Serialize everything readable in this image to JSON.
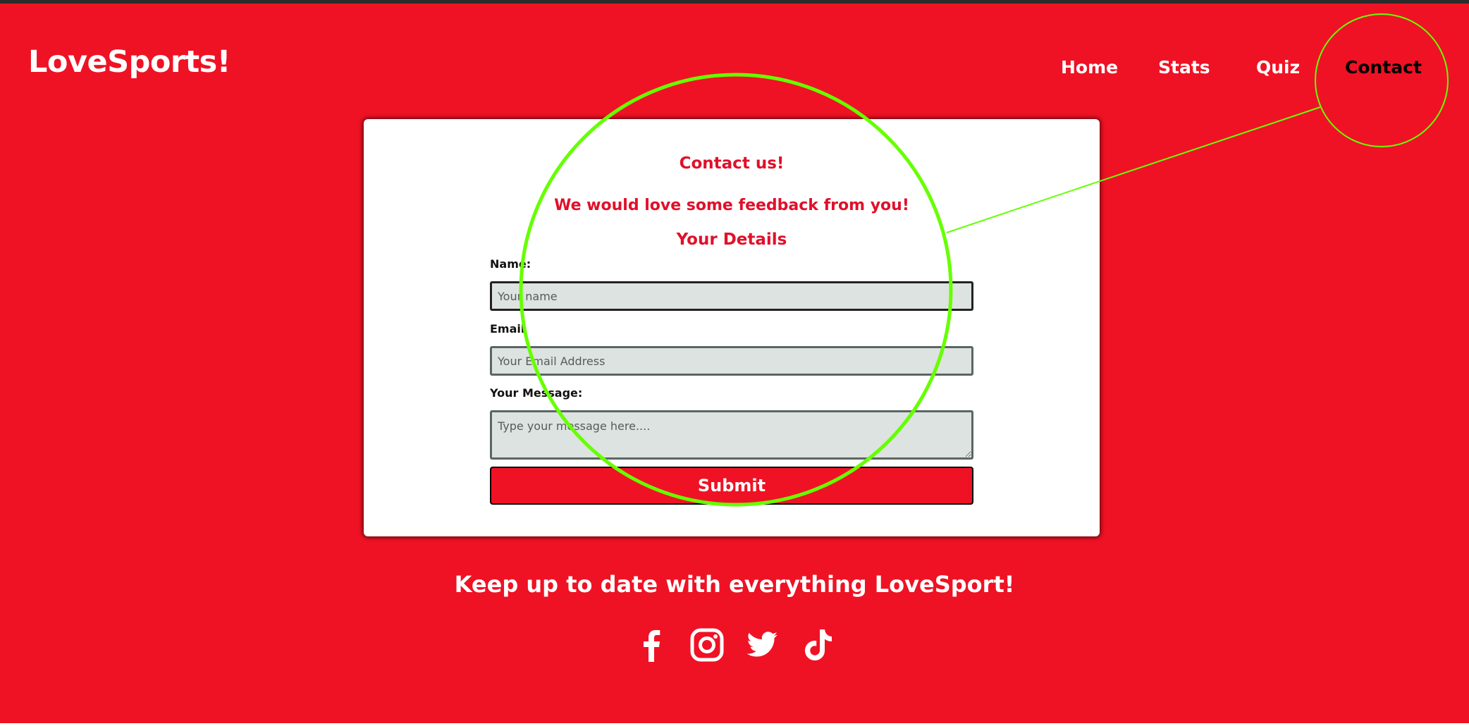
{
  "brand": {
    "logo": "LoveSports!"
  },
  "nav": {
    "items": [
      {
        "label": "Home",
        "active": false
      },
      {
        "label": "Stats",
        "active": false
      },
      {
        "label": "Quiz",
        "active": false
      },
      {
        "label": "Contact",
        "active": true
      }
    ]
  },
  "contact": {
    "title": "Contact us!",
    "subtitle": "We would love some feedback from you!",
    "details_heading": "Your Details",
    "fields": {
      "name": {
        "label": "Name:",
        "placeholder": "Your name"
      },
      "email": {
        "label": "Email",
        "placeholder": "Your Email Address"
      },
      "message": {
        "label": "Your Message:",
        "placeholder": "Type your message here...."
      }
    },
    "submit_label": "Submit"
  },
  "footer": {
    "heading": "Keep up to date with everything LoveSport!",
    "social": [
      {
        "icon": "facebook-icon"
      },
      {
        "icon": "instagram-icon"
      },
      {
        "icon": "twitter-icon"
      },
      {
        "icon": "tiktok-icon"
      }
    ]
  },
  "colors": {
    "background": "#ef1224",
    "accent_text": "#e0102a",
    "annotation": "#66ff00"
  }
}
